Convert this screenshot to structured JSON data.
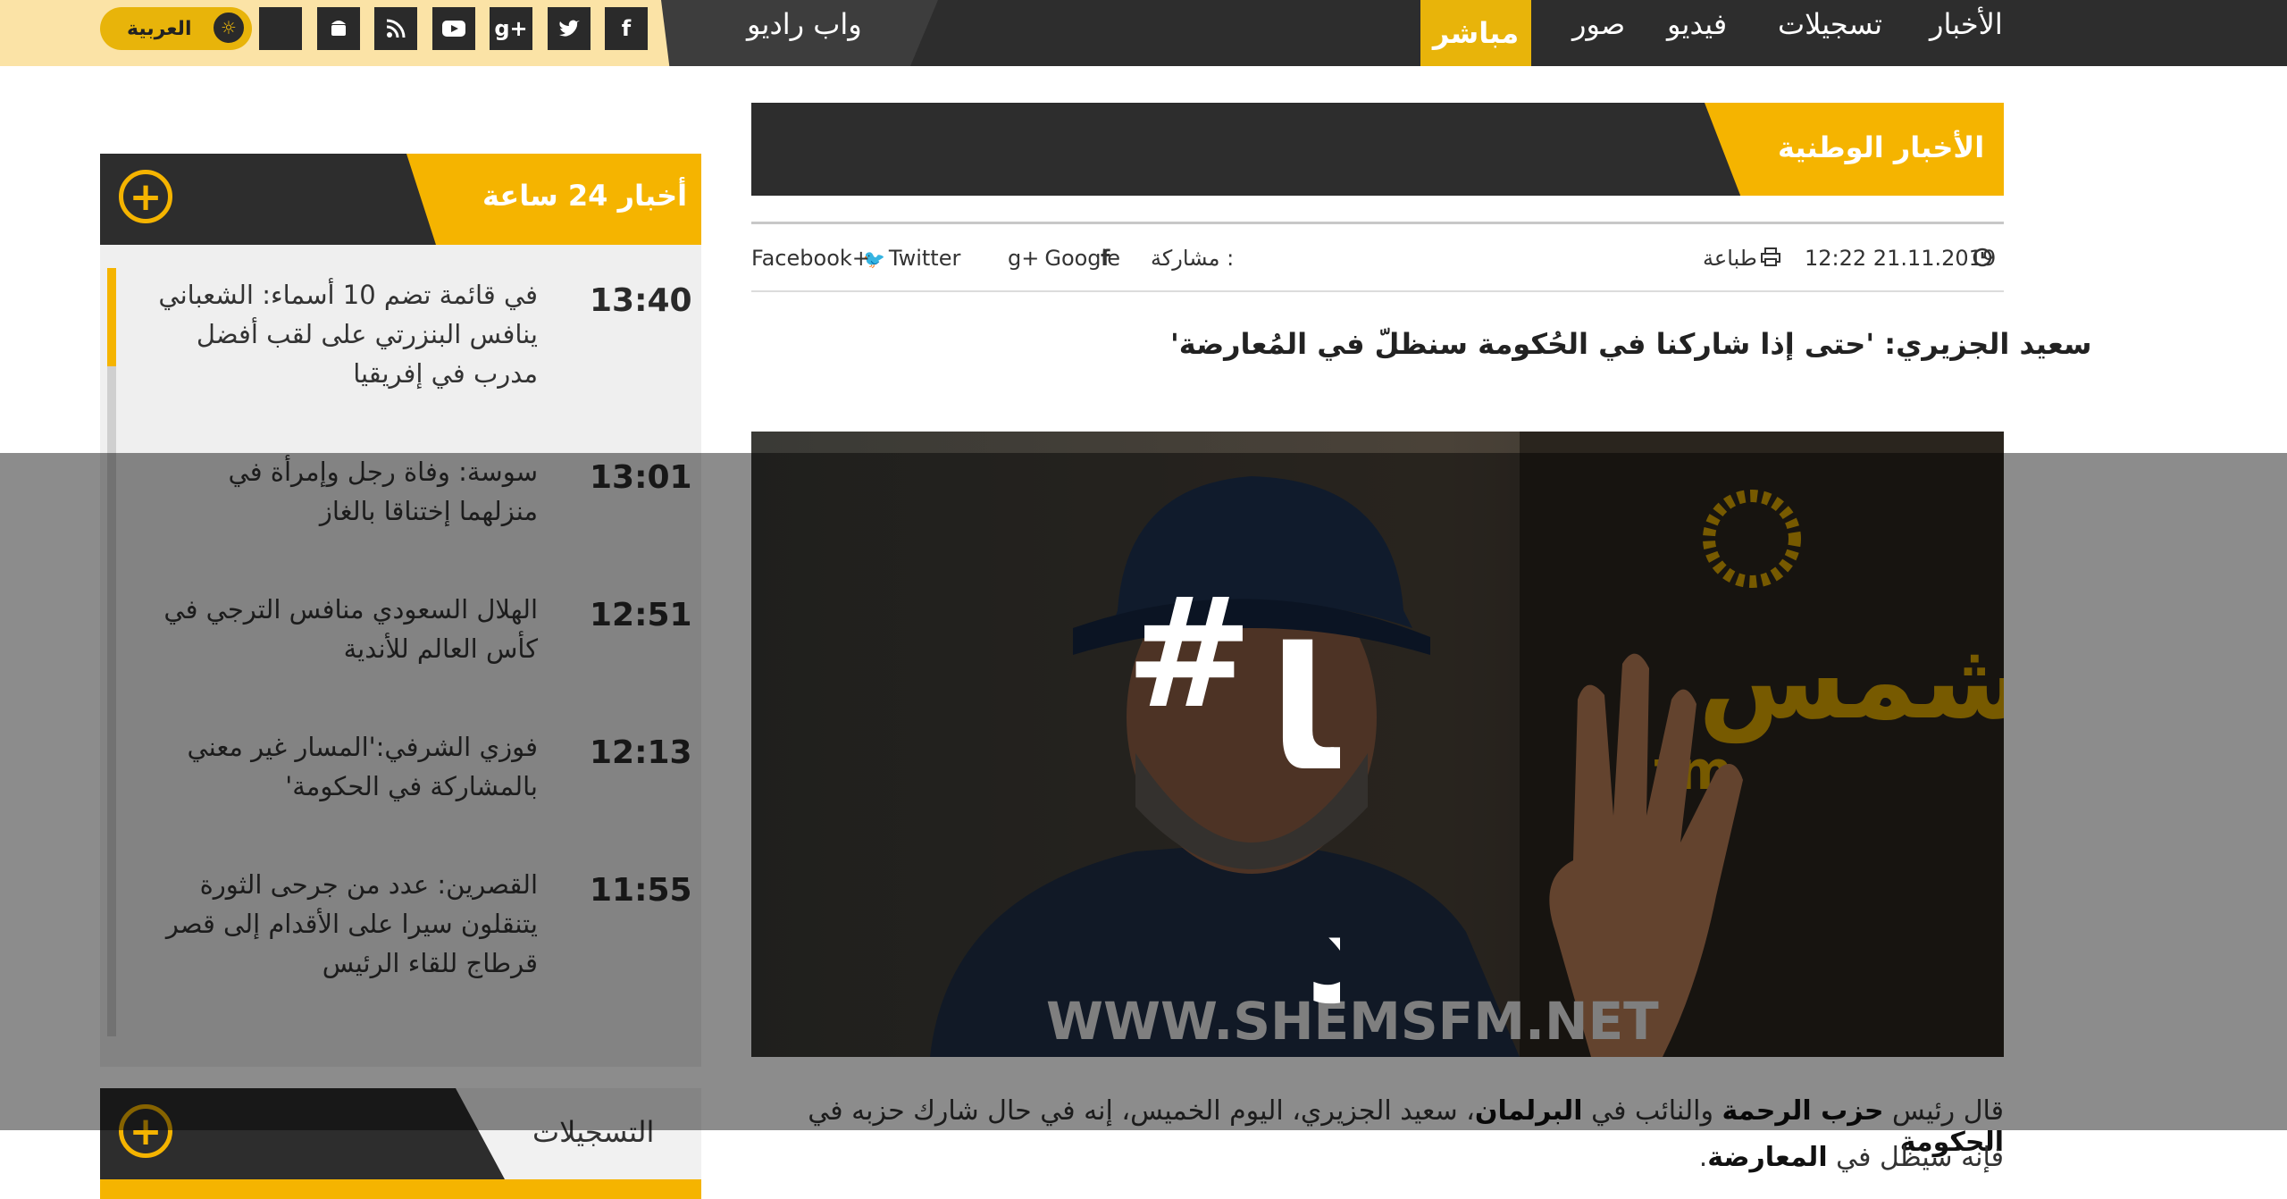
{
  "topbar": {
    "language_label": "العربية",
    "radio_label": "واب راديو",
    "social_icons": [
      "facebook-icon",
      "twitter-icon",
      "google-plus-icon",
      "youtube-icon",
      "rss-icon",
      "android-icon",
      "apple-icon"
    ]
  },
  "nav": {
    "news": "الأخبار",
    "recordings": "تسجيلات",
    "video": "فيديو",
    "photos": "صور",
    "live": "مباشر"
  },
  "section": {
    "title": "الأخبار الوطنية"
  },
  "meta": {
    "datetime": "12:22 21.11.2019",
    "print_label": "طباعة",
    "share_label": "مشاركة :",
    "share_google": "Google",
    "share_twitter": "Twitter",
    "share_facebook": "Facebook+"
  },
  "article": {
    "headline": "سعيد الجزيري: 'حتى إذا شاركنا في الحُكومة سنظلّ في المُعارضة'",
    "image_watermark": "WWW.SHEMSFM.NET",
    "image_brand": "شمس",
    "image_brand_latin": "fm",
    "body_line1_parts": [
      "قال رئيس ",
      "حزب الرحمة",
      " والنائب في ",
      "البرلمان",
      "، سعيد الجزيري، اليوم الخميس، إنه في حال شارك حزبه في ",
      "الحكومة"
    ],
    "body_line2_parts": [
      "فإنه سيظل في ",
      "المعارضة",
      "."
    ]
  },
  "overlay": {
    "campaign_hash": "#",
    "campaign_line1": "ليتها",
    "campaign_line2": "الحدود"
  },
  "sidebar": {
    "title": "أخبار 24 ساعة",
    "items": [
      {
        "time": "13:40",
        "text": "في قائمة تضم 10 أسماء: الشعباني ينافس البنزرتي على لقب أفضل مدرب في إفريقيا"
      },
      {
        "time": "13:01",
        "text": "سوسة: وفاة رجل وإمرأة في منزلهما إختناقا بالغاز"
      },
      {
        "time": "12:51",
        "text": "الهلال السعودي منافس الترجي في كأس العالم للأندية"
      },
      {
        "time": "12:13",
        "text": "فوزي الشرفي:'المسار غير معني بالمشاركة في الحكومة'"
      },
      {
        "time": "11:55",
        "text": "القصرين: عدد من جرحى الثورة يتنقلون سيرا على الأقدام إلى قصر قرطاج للقاء الرئيس"
      }
    ],
    "section2_title": "التسجيلات"
  },
  "colors": {
    "accent": "#f5b400",
    "dark": "#2d2d2d",
    "topbar_left": "#fbe3a6"
  }
}
